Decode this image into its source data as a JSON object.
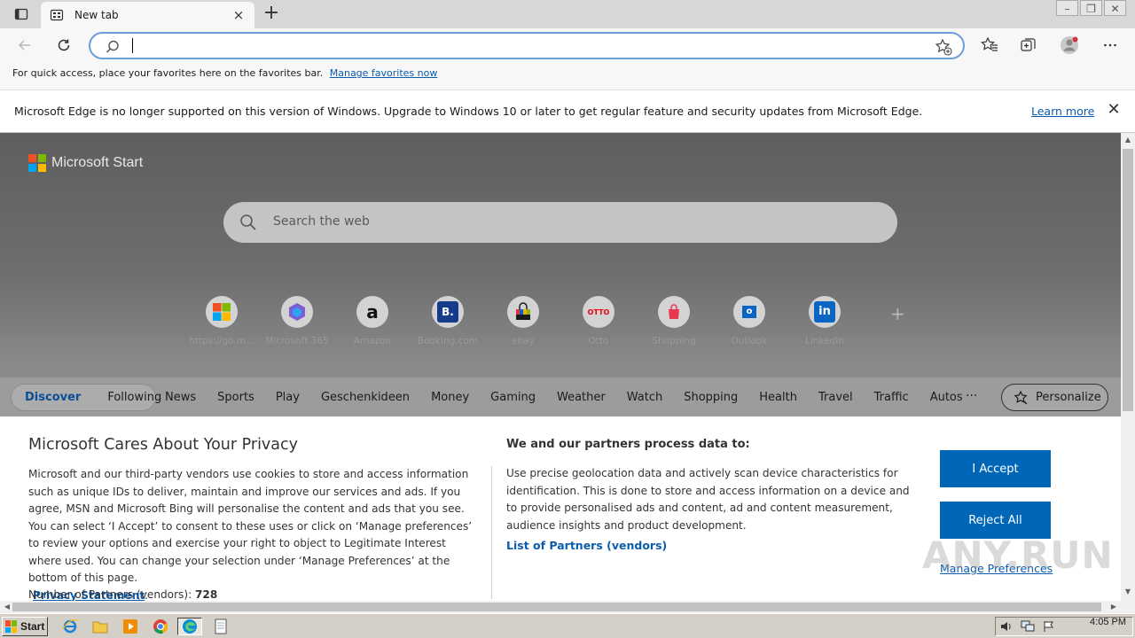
{
  "window": {
    "tab_title": "New tab",
    "new_tab_symbol": "+",
    "tab_close_symbol": "×",
    "minimize_symbol": "–",
    "restore_symbol": "❐",
    "close_symbol": "✕"
  },
  "toolbar": {
    "address_value": "",
    "address_placeholder": "",
    "icons": [
      "back-arrow-icon",
      "refresh-icon",
      "search-icon",
      "add-favorite-icon",
      "favorites-icon",
      "collections-icon",
      "profile-icon",
      "more-icon"
    ]
  },
  "favorites_bar": {
    "message": "For quick access, place your favorites here on the favorites bar.",
    "link": "Manage favorites now"
  },
  "notice": {
    "message": "Microsoft Edge is no longer supported on this version of Windows. Upgrade to Windows 10 or later to get regular feature and security updates from Microsoft Edge.",
    "link": "Learn more",
    "close_symbol": "✕"
  },
  "start_page": {
    "brand": "Microsoft Start",
    "brand_colors": [
      "#f25022",
      "#7fba00",
      "#00a4ef",
      "#ffb900"
    ],
    "search_placeholder": "Search the web",
    "quick_links": [
      {
        "label": "https://go.m...",
        "icon": "microsoft-tiles-icon",
        "glyph": ""
      },
      {
        "label": "Microsoft 365",
        "icon": "microsoft-365-icon",
        "glyph": ""
      },
      {
        "label": "Amazon",
        "icon": "amazon-icon",
        "glyph": "a"
      },
      {
        "label": "Booking.com",
        "icon": "booking-icon",
        "glyph": "B."
      },
      {
        "label": "ebay",
        "icon": "ebay-bag-icon",
        "glyph": ""
      },
      {
        "label": "Otto",
        "icon": "otto-icon",
        "glyph": "OTTO"
      },
      {
        "label": "Shopping",
        "icon": "shopping-bag-icon",
        "glyph": ""
      },
      {
        "label": "Outlook",
        "icon": "outlook-icon",
        "glyph": "o"
      },
      {
        "label": "LinkedIn",
        "icon": "linkedin-icon",
        "glyph": "in"
      }
    ],
    "add_symbol": "+",
    "nav_pill": [
      "Discover",
      "Following"
    ],
    "nav_items": [
      "News",
      "Sports",
      "Play",
      "Geschenkideen",
      "Money",
      "Gaming",
      "Weather",
      "Watch",
      "Shopping",
      "Health",
      "Travel",
      "Traffic",
      "Autos"
    ],
    "nav_more": "···",
    "personalize": "Personalize"
  },
  "privacy": {
    "title": "Microsoft Cares About Your Privacy",
    "body": "Microsoft and our third-party vendors use cookies to store and access information such as unique IDs to deliver, maintain and improve our services and ads. If you agree, MSN and Microsoft Bing will personalise the content and ads that you see. You can select ‘I Accept’ to consent to these uses or click on ‘Manage preferences’ to review your options and exercise your right to object to Legitimate Interest where used.  You can change your selection under ‘Manage Preferences’ at the bottom of this page.",
    "privacy_link": "Privacy Statement",
    "privacy_link_suffix": ".",
    "partners_label": "Number of Partners (vendors):",
    "partners_count": "728",
    "right_title": "We and our partners process data to:",
    "right_body": "Use precise geolocation data and actively scan device characteristics for identification. This is done to store and access information on a device and to provide personalised ads and content, ad and content measurement, audience insights and product development.",
    "list_link": "List of Partners (vendors)",
    "accept": "I Accept",
    "reject": "Reject All",
    "manage": "Manage Preferences",
    "accent_color": "#0067b8"
  },
  "watermark": "ANY.RUN",
  "taskbar": {
    "start": "Start",
    "apps": [
      "ie-icon",
      "folder-icon",
      "media-player-icon",
      "chrome-icon",
      "edge-icon",
      "notepad-icon"
    ],
    "tray_icons": [
      "volume-icon",
      "network-icon",
      "flag-icon"
    ],
    "time": "4:05 PM"
  }
}
